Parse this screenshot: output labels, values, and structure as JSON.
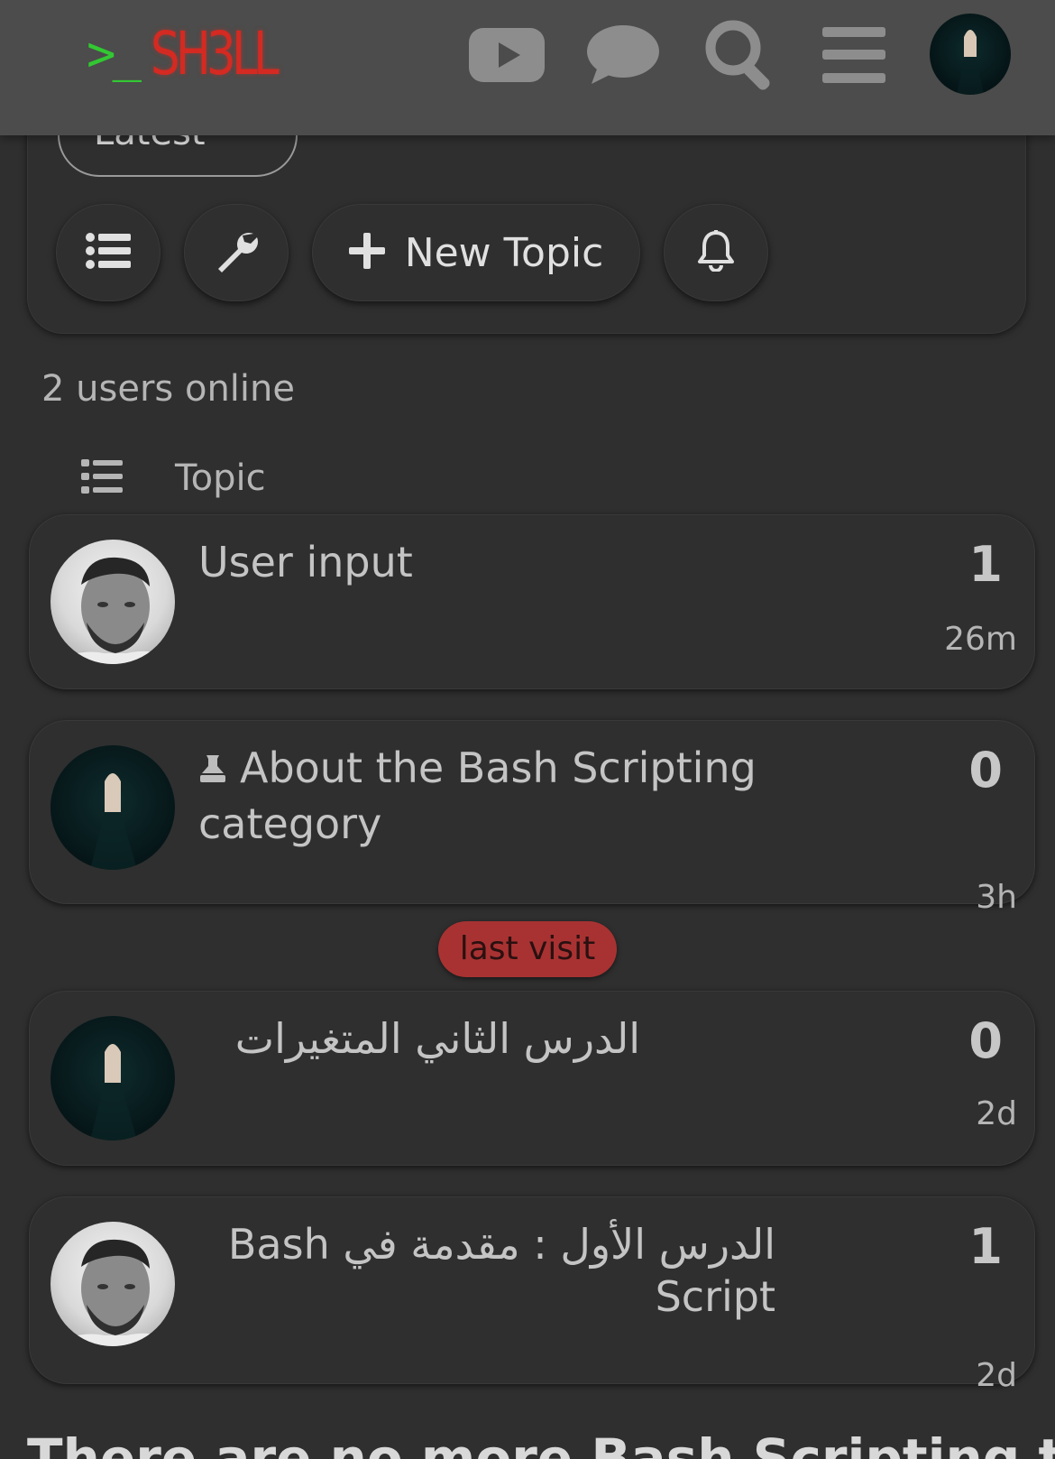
{
  "header": {
    "logo_prompt": ">_",
    "logo_text": "SH3LL",
    "icons": [
      "youtube-icon",
      "chat-icon",
      "search-icon",
      "hamburger-menu-icon",
      "user-avatar"
    ]
  },
  "filters": {
    "latest_label": "Latest",
    "new_topic_label": "New Topic"
  },
  "users_online": "2 users online",
  "list_header": {
    "topic_label": "Topic"
  },
  "topics": [
    {
      "title": "User input",
      "replies": "1",
      "age": "26m",
      "avatar": "user-photo"
    },
    {
      "title": "About the Bash Scripting category",
      "replies": "0",
      "age": "3h",
      "avatar": "window-photo",
      "pinned": true
    },
    {
      "title": "الدرس الثاني المتغيرات",
      "replies": "0",
      "age": "2d",
      "avatar": "window-photo"
    },
    {
      "title": "الدرس الأول : مقدمة في Bash Script",
      "replies": "1",
      "age": "2d",
      "avatar": "user-photo"
    }
  ],
  "last_visit_label": "last visit",
  "bottom_heading": "There are no more Bash Scripting topics.",
  "colors": {
    "background": "#2f2f2f",
    "header": "#4b4c4b",
    "logo_green": "#32c832",
    "logo_red": "#d42a22",
    "last_visit_badge": "#a83232"
  }
}
